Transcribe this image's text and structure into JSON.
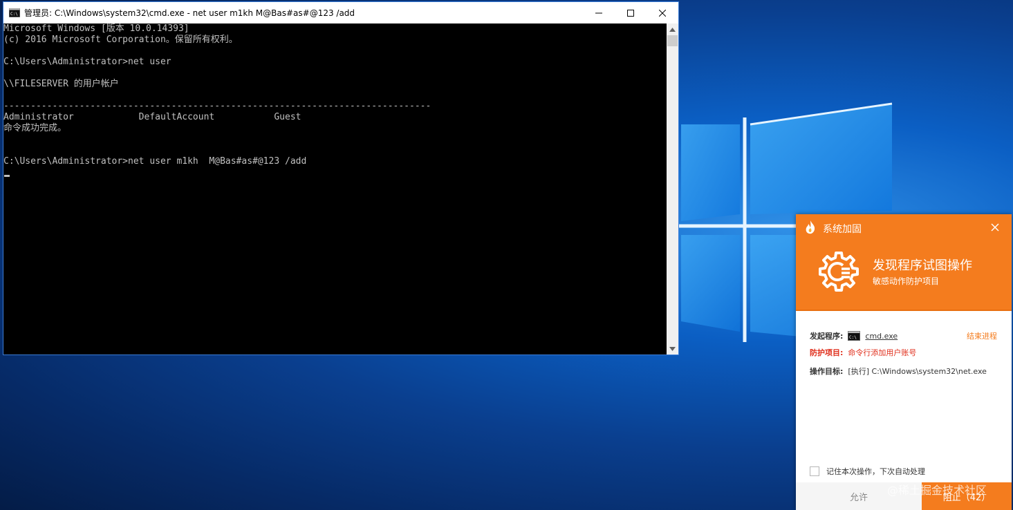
{
  "cmd_window": {
    "title": "管理员: C:\\Windows\\system32\\cmd.exe - net  user m1kh  M@Bas#as#@123 /add",
    "output": "Microsoft Windows [版本 10.0.14393]\n(c) 2016 Microsoft Corporation。保留所有权利。\n\nC:\\Users\\Administrator>net user\n\n\\\\FILESERVER 的用户帐户\n\n-------------------------------------------------------------------------------\nAdministrator            DefaultAccount           Guest\n命令成功完成。\n\n\nC:\\Users\\Administrator>net user m1kh  M@Bas#as#@123 /add",
    "controls": {
      "minimize_icon": "minimize-icon",
      "maximize_icon": "maximize-icon",
      "close_icon": "close-icon"
    }
  },
  "popup": {
    "app_title": "系统加固",
    "headline": "发现程序试图操作",
    "subline": "敏感动作防护项目",
    "initiator_label": "发起程序:",
    "initiator_value": "cmd.exe",
    "end_process": "结束进程",
    "protect_label": "防护项目:",
    "protect_value": "命令行添加用户账号",
    "target_label": "操作目标:",
    "target_value": "[执行] C:\\Windows\\system32\\net.exe",
    "remember_label": "记住本次操作，下次自动处理",
    "allow_button": "允许",
    "block_button": "阻止（42）",
    "colors": {
      "accent": "#f47c1e",
      "danger": "#e02e1b"
    }
  },
  "watermark": "@稀土掘金技术社区"
}
